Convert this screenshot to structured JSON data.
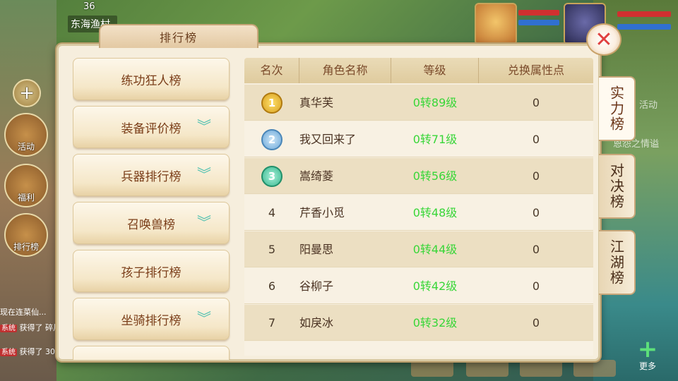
{
  "hud": {
    "top_number": "36",
    "map_name": "东海渔村"
  },
  "side_icons": [
    {
      "label": "活动"
    },
    {
      "label": "福利"
    },
    {
      "label": "排行榜"
    }
  ],
  "chat": [
    {
      "tag": "",
      "text": "现在连菜仙..."
    },
    {
      "tag": "系统",
      "text": "获得了 碎片"
    },
    {
      "tag": "系统",
      "text": "获得了 30元"
    }
  ],
  "bottom_more": "更多",
  "panel": {
    "title": "排行榜",
    "close_glyph": "✕"
  },
  "menu": [
    {
      "label": "练功狂人榜",
      "has_dropdown": false
    },
    {
      "label": "装备评价榜",
      "has_dropdown": true
    },
    {
      "label": "兵器排行榜",
      "has_dropdown": true
    },
    {
      "label": "召唤兽榜",
      "has_dropdown": true
    },
    {
      "label": "孩子排行榜",
      "has_dropdown": false
    },
    {
      "label": "坐骑排行榜",
      "has_dropdown": true
    }
  ],
  "table": {
    "headers": [
      "名次",
      "角色名称",
      "等级",
      "兑换属性点"
    ],
    "rows": [
      {
        "rank": "1",
        "name": "真华芙",
        "level": "0转89级",
        "points": "0",
        "medal": "gold"
      },
      {
        "rank": "2",
        "name": "我又回来了",
        "level": "0转71级",
        "points": "0",
        "medal": "silver"
      },
      {
        "rank": "3",
        "name": "嵩绮菱",
        "level": "0转56级",
        "points": "0",
        "medal": "bronze"
      },
      {
        "rank": "4",
        "name": "芹香小觅",
        "level": "0转48级",
        "points": "0",
        "medal": ""
      },
      {
        "rank": "5",
        "name": "阳曼思",
        "level": "0转44级",
        "points": "0",
        "medal": ""
      },
      {
        "rank": "6",
        "name": "谷柳子",
        "level": "0转42级",
        "points": "0",
        "medal": ""
      },
      {
        "rank": "7",
        "name": "如戾冰",
        "level": "0转32级",
        "points": "0",
        "medal": ""
      }
    ]
  },
  "right_tabs": [
    {
      "label": "实力榜",
      "active": true
    },
    {
      "label": "对决榜",
      "active": false
    },
    {
      "label": "江湖榜",
      "active": false
    }
  ],
  "background_text": {
    "activity": "活动",
    "feelings": "恩怨之情谥"
  }
}
